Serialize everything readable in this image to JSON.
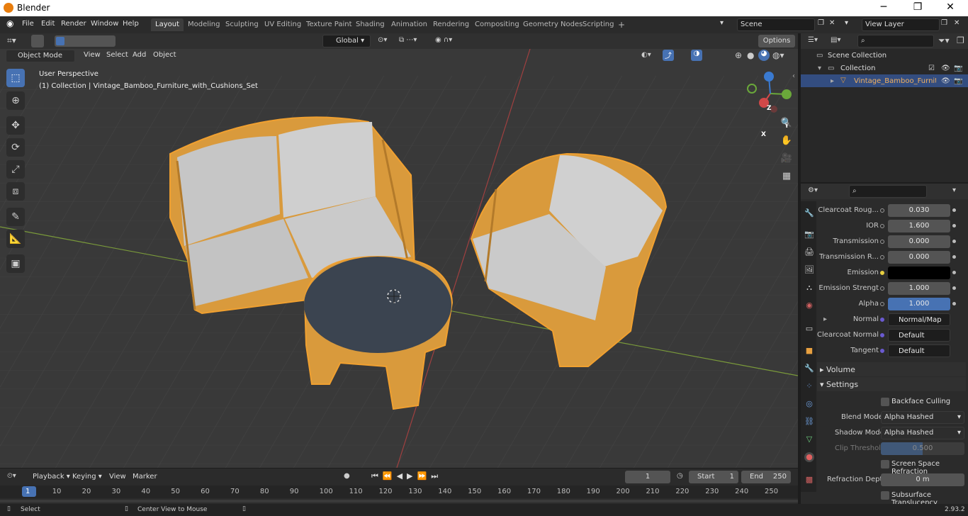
{
  "window": {
    "title": "Blender",
    "version": "2.93.2"
  },
  "menu": [
    "File",
    "Edit",
    "Render",
    "Window",
    "Help"
  ],
  "workspaces": [
    "Layout",
    "Modeling",
    "Sculpting",
    "UV Editing",
    "Texture Paint",
    "Shading",
    "Animation",
    "Rendering",
    "Compositing",
    "Geometry Nodes",
    "Scripting"
  ],
  "scene": {
    "name": "Scene",
    "view_layer": "View Layer"
  },
  "viewport": {
    "transform": "Global",
    "options": "Options",
    "mode": "Object Mode",
    "menus": [
      "View",
      "Select",
      "Add",
      "Object"
    ],
    "overlay_line1": "User Perspective",
    "overlay_line2": "(1) Collection | Vintage_Bamboo_Furniture_with_Cushions_Set",
    "gizmo": {
      "x": "X",
      "y": "Y",
      "z": "Z"
    }
  },
  "outliner": {
    "scene_collection": "Scene Collection",
    "collection": "Collection",
    "object": "Vintage_Bamboo_Furnitu"
  },
  "properties": {
    "rows": [
      {
        "label": "Clearcoat Roug...",
        "value": "0.030",
        "style": "normal"
      },
      {
        "label": "IOR",
        "value": "1.600",
        "style": "normal"
      },
      {
        "label": "Transmission",
        "value": "0.000",
        "style": "normal"
      },
      {
        "label": "Transmission R...",
        "value": "0.000",
        "style": "normal"
      },
      {
        "label": "Emission",
        "value": "",
        "style": "black"
      },
      {
        "label": "Emission Strengt",
        "value": "1.000",
        "style": "normal"
      },
      {
        "label": "Alpha",
        "value": "1.000",
        "style": "blue"
      },
      {
        "label": "Normal",
        "value": "Normal/Map",
        "style": "link"
      },
      {
        "label": "Clearcoat Normal",
        "value": "Default",
        "style": "link"
      },
      {
        "label": "Tangent",
        "value": "Default",
        "style": "link"
      }
    ],
    "volume": "Volume",
    "settings": "Settings",
    "backface": "Backface Culling",
    "blend_mode_label": "Blend Mode",
    "blend_mode": "Alpha Hashed",
    "shadow_mode_label": "Shadow Mode",
    "shadow_mode": "Alpha Hashed",
    "clip_label": "Clip Threshold",
    "clip_value": "0.500",
    "ssr": "Screen Space Refraction",
    "refraction_label": "Refraction Depth",
    "refraction_value": "0 m",
    "sss": "Subsurface Translucency"
  },
  "timeline": {
    "menus": [
      "Playback",
      "Keying",
      "View",
      "Marker"
    ],
    "current": "1",
    "start_label": "Start",
    "start": "1",
    "end_label": "End",
    "end": "250",
    "ticks": [
      "1",
      "10",
      "20",
      "30",
      "40",
      "50",
      "60",
      "70",
      "80",
      "90",
      "100",
      "110",
      "120",
      "130",
      "140",
      "150",
      "160",
      "170",
      "180",
      "190",
      "200",
      "210",
      "220",
      "230",
      "240",
      "250"
    ]
  },
  "status": {
    "left": "Select",
    "middle": "Center View to Mouse"
  },
  "colors": {
    "accent": "#4772b3",
    "selection": "#e8a040",
    "bamboo": "#d99a3c",
    "cushion": "#c9c9c9",
    "tabletop": "#3b4450"
  }
}
